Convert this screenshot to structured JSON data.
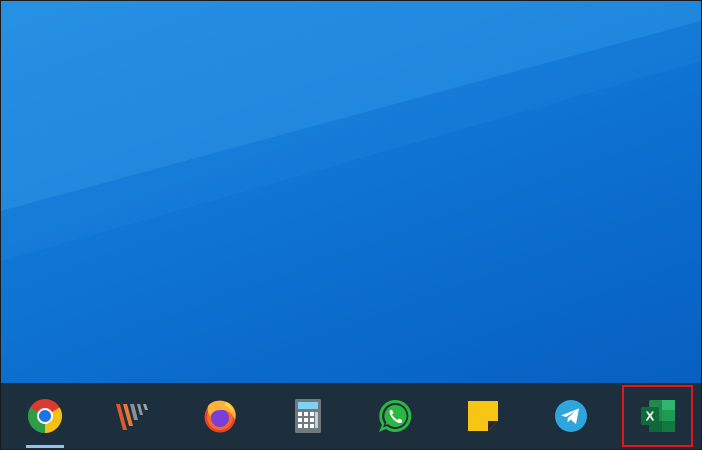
{
  "colors": {
    "taskbar_bg": "#1d2f3d",
    "highlight_box": "#e5161b",
    "active_indicator": "#8fc4ef"
  },
  "taskbar": {
    "items": [
      {
        "icon": "chrome-icon",
        "active": true
      },
      {
        "icon": "app-icon",
        "active": false
      },
      {
        "icon": "firefox-icon",
        "active": false
      },
      {
        "icon": "calculator-icon",
        "active": false
      },
      {
        "icon": "whatsapp-icon",
        "active": false
      },
      {
        "icon": "sticky-notes-icon",
        "active": false
      },
      {
        "icon": "telegram-icon",
        "active": false
      },
      {
        "icon": "excel-icon",
        "active": false,
        "highlighted": true,
        "label": "X"
      }
    ]
  }
}
